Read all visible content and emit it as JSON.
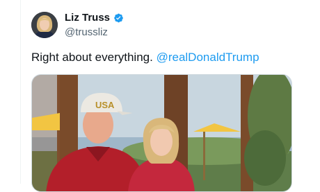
{
  "tweet": {
    "author": {
      "display_name": "Liz Truss",
      "handle": "@trussliz",
      "verified": true,
      "verified_icon": "verified-badge-icon",
      "verified_color": "#1d9bf0"
    },
    "text": "Right about everything.",
    "mention": "@realDonaldTrump",
    "media": {
      "type": "photo",
      "cap_text": "USA"
    }
  },
  "colors": {
    "link": "#1d9bf0",
    "handle": "#536471",
    "text": "#0f1419"
  }
}
